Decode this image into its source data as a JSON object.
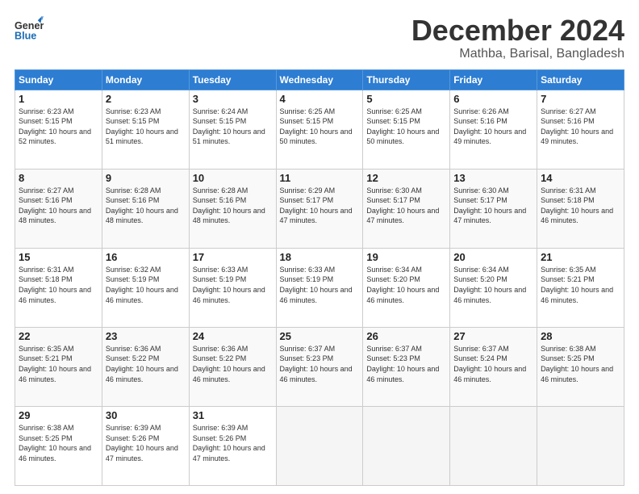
{
  "header": {
    "logo_general": "General",
    "logo_blue": "Blue",
    "month_title": "December 2024",
    "location": "Mathba, Barisal, Bangladesh"
  },
  "days_of_week": [
    "Sunday",
    "Monday",
    "Tuesday",
    "Wednesday",
    "Thursday",
    "Friday",
    "Saturday"
  ],
  "weeks": [
    [
      {
        "day": "1",
        "sunrise": "6:23 AM",
        "sunset": "5:15 PM",
        "daylight": "10 hours and 52 minutes."
      },
      {
        "day": "2",
        "sunrise": "6:23 AM",
        "sunset": "5:15 PM",
        "daylight": "10 hours and 51 minutes."
      },
      {
        "day": "3",
        "sunrise": "6:24 AM",
        "sunset": "5:15 PM",
        "daylight": "10 hours and 51 minutes."
      },
      {
        "day": "4",
        "sunrise": "6:25 AM",
        "sunset": "5:15 PM",
        "daylight": "10 hours and 50 minutes."
      },
      {
        "day": "5",
        "sunrise": "6:25 AM",
        "sunset": "5:15 PM",
        "daylight": "10 hours and 50 minutes."
      },
      {
        "day": "6",
        "sunrise": "6:26 AM",
        "sunset": "5:16 PM",
        "daylight": "10 hours and 49 minutes."
      },
      {
        "day": "7",
        "sunrise": "6:27 AM",
        "sunset": "5:16 PM",
        "daylight": "10 hours and 49 minutes."
      }
    ],
    [
      {
        "day": "8",
        "sunrise": "6:27 AM",
        "sunset": "5:16 PM",
        "daylight": "10 hours and 48 minutes."
      },
      {
        "day": "9",
        "sunrise": "6:28 AM",
        "sunset": "5:16 PM",
        "daylight": "10 hours and 48 minutes."
      },
      {
        "day": "10",
        "sunrise": "6:28 AM",
        "sunset": "5:16 PM",
        "daylight": "10 hours and 48 minutes."
      },
      {
        "day": "11",
        "sunrise": "6:29 AM",
        "sunset": "5:17 PM",
        "daylight": "10 hours and 47 minutes."
      },
      {
        "day": "12",
        "sunrise": "6:30 AM",
        "sunset": "5:17 PM",
        "daylight": "10 hours and 47 minutes."
      },
      {
        "day": "13",
        "sunrise": "6:30 AM",
        "sunset": "5:17 PM",
        "daylight": "10 hours and 47 minutes."
      },
      {
        "day": "14",
        "sunrise": "6:31 AM",
        "sunset": "5:18 PM",
        "daylight": "10 hours and 46 minutes."
      }
    ],
    [
      {
        "day": "15",
        "sunrise": "6:31 AM",
        "sunset": "5:18 PM",
        "daylight": "10 hours and 46 minutes."
      },
      {
        "day": "16",
        "sunrise": "6:32 AM",
        "sunset": "5:19 PM",
        "daylight": "10 hours and 46 minutes."
      },
      {
        "day": "17",
        "sunrise": "6:33 AM",
        "sunset": "5:19 PM",
        "daylight": "10 hours and 46 minutes."
      },
      {
        "day": "18",
        "sunrise": "6:33 AM",
        "sunset": "5:19 PM",
        "daylight": "10 hours and 46 minutes."
      },
      {
        "day": "19",
        "sunrise": "6:34 AM",
        "sunset": "5:20 PM",
        "daylight": "10 hours and 46 minutes."
      },
      {
        "day": "20",
        "sunrise": "6:34 AM",
        "sunset": "5:20 PM",
        "daylight": "10 hours and 46 minutes."
      },
      {
        "day": "21",
        "sunrise": "6:35 AM",
        "sunset": "5:21 PM",
        "daylight": "10 hours and 46 minutes."
      }
    ],
    [
      {
        "day": "22",
        "sunrise": "6:35 AM",
        "sunset": "5:21 PM",
        "daylight": "10 hours and 46 minutes."
      },
      {
        "day": "23",
        "sunrise": "6:36 AM",
        "sunset": "5:22 PM",
        "daylight": "10 hours and 46 minutes."
      },
      {
        "day": "24",
        "sunrise": "6:36 AM",
        "sunset": "5:22 PM",
        "daylight": "10 hours and 46 minutes."
      },
      {
        "day": "25",
        "sunrise": "6:37 AM",
        "sunset": "5:23 PM",
        "daylight": "10 hours and 46 minutes."
      },
      {
        "day": "26",
        "sunrise": "6:37 AM",
        "sunset": "5:23 PM",
        "daylight": "10 hours and 46 minutes."
      },
      {
        "day": "27",
        "sunrise": "6:37 AM",
        "sunset": "5:24 PM",
        "daylight": "10 hours and 46 minutes."
      },
      {
        "day": "28",
        "sunrise": "6:38 AM",
        "sunset": "5:25 PM",
        "daylight": "10 hours and 46 minutes."
      }
    ],
    [
      {
        "day": "29",
        "sunrise": "6:38 AM",
        "sunset": "5:25 PM",
        "daylight": "10 hours and 46 minutes."
      },
      {
        "day": "30",
        "sunrise": "6:39 AM",
        "sunset": "5:26 PM",
        "daylight": "10 hours and 47 minutes."
      },
      {
        "day": "31",
        "sunrise": "6:39 AM",
        "sunset": "5:26 PM",
        "daylight": "10 hours and 47 minutes."
      },
      null,
      null,
      null,
      null
    ]
  ]
}
